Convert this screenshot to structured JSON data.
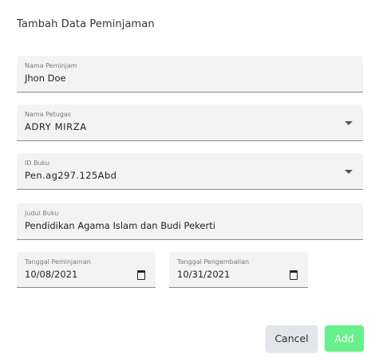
{
  "dialog": {
    "title": "Tambah Data Peminjaman",
    "fields": {
      "nama_peminjam": {
        "label": "Nama Peminjam",
        "value": "Jhon Doe"
      },
      "nama_petugas": {
        "label": "Nama Petugas",
        "value": "ADRY MIRZA"
      },
      "id_buku": {
        "label": "ID Buku",
        "value": "Pen.ag297.125Abd"
      },
      "judul_buku": {
        "label": "Judul Buku",
        "value": "Pendidikan Agama Islam dan Budi Pekerti"
      },
      "tanggal_peminjaman": {
        "label": "Tanggal Peminjaman",
        "value": "10/08/2021"
      },
      "tanggal_pengembalian": {
        "label": "Tanggal Pengembalian",
        "value": "10/31/2021"
      }
    },
    "actions": {
      "cancel_label": "Cancel",
      "add_label": "Add"
    }
  },
  "colors": {
    "add_button": "#69f08c",
    "cancel_button": "#e2e6ea",
    "field_background": "#f3f3f3"
  },
  "icons": {
    "dropdown": "chevron-down-icon",
    "date": "calendar-icon"
  }
}
